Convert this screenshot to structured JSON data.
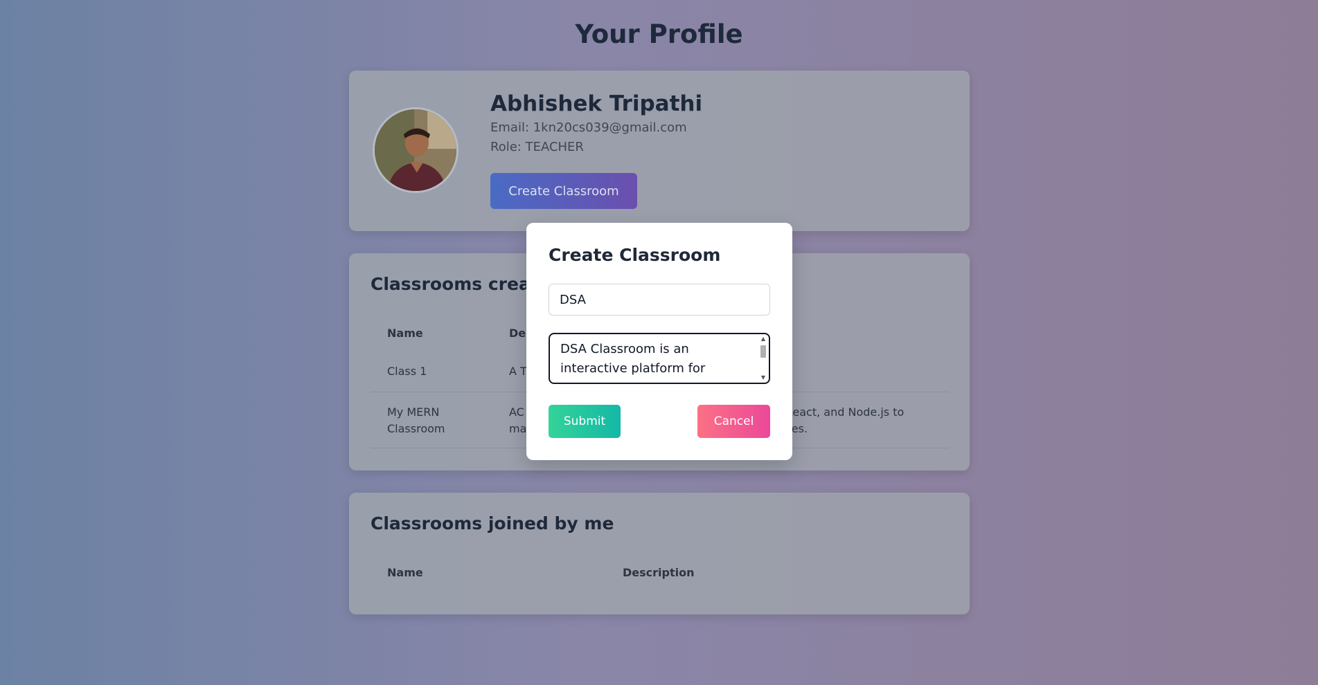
{
  "page": {
    "title": "Your Profile"
  },
  "profile": {
    "name": "Abhishek Tripathi",
    "email": "Email: 1kn20cs039@gmail.com",
    "role": "Role: TEACHER",
    "create_button": "Create Classroom"
  },
  "created_section": {
    "title": "Classrooms created by me",
    "columns": [
      "Name",
      "Description"
    ],
    "rows": [
      {
        "name": "Class 1",
        "description": "A T"
      },
      {
        "name_line1": "My MERN",
        "name_line2": "Classroom",
        "desc_left_line1": "AC",
        "desc_left_line2": "ma",
        "desc_right_line1": "React, and Node.js to",
        "desc_right_line2": "ces."
      }
    ]
  },
  "joined_section": {
    "title": "Classrooms joined by me",
    "columns": [
      "Name",
      "Description"
    ]
  },
  "modal": {
    "title": "Create Classroom",
    "name_value": "DSA",
    "description_value": "DSA Classroom is an interactive platform for",
    "submit_label": "Submit",
    "cancel_label": "Cancel"
  },
  "colors": {
    "submit": "#34d399",
    "cancel": "#fb7185",
    "create_button": "#4a6bc4"
  },
  "icons": {
    "scroll_up": "▲",
    "scroll_down": "▼"
  }
}
